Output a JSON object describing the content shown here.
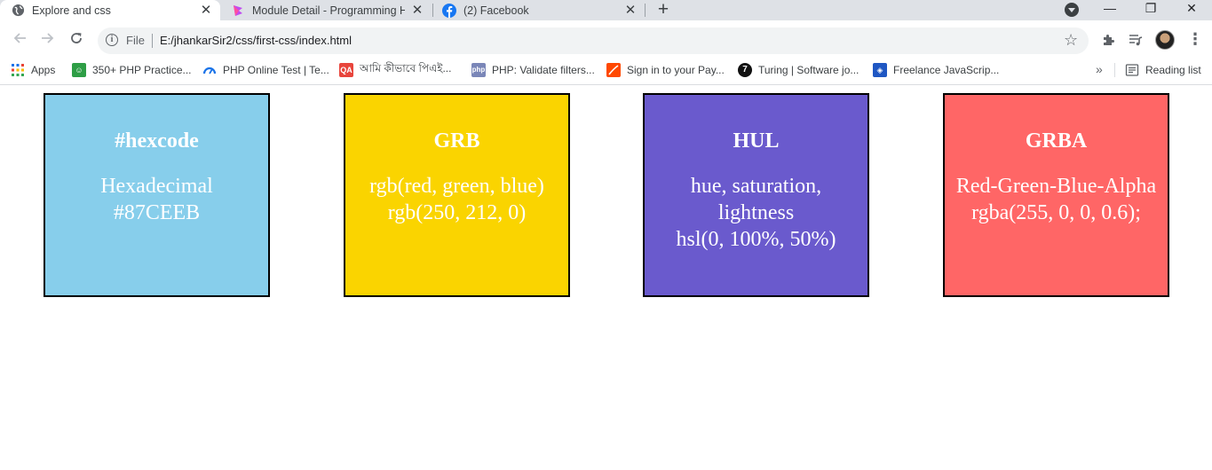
{
  "browser": {
    "tabs": [
      {
        "title": "Explore and css",
        "favicon": "globe-icon",
        "active": true
      },
      {
        "title": "Module Detail - Programming He",
        "favicon": "programming-hero-icon",
        "active": false
      },
      {
        "title": "(2) Facebook",
        "favicon": "facebook-icon",
        "active": false
      }
    ],
    "new_tab_label": "+",
    "window_controls": {
      "minimize": "—",
      "restore": "❐",
      "close": "✕"
    },
    "address": {
      "scheme_label": "File",
      "url": "E:/jhankarSir2/css/first-css/index.html"
    },
    "bookmarks": [
      {
        "label": "Apps",
        "icon": "apps-grid-icon"
      },
      {
        "label": "350+ PHP Practice...",
        "icon": "php-practice-icon"
      },
      {
        "label": "PHP Online Test | Te...",
        "icon": "php-test-icon"
      },
      {
        "label": "আমি কীভাবে পিএই...",
        "icon": "qa-icon"
      },
      {
        "label": "PHP: Validate filters...",
        "icon": "php-icon"
      },
      {
        "label": "Sign in to your Pay...",
        "icon": "payoneer-icon"
      },
      {
        "label": "Turing | Software jo...",
        "icon": "turing-icon"
      },
      {
        "label": "Freelance JavaScrip...",
        "icon": "freelance-icon"
      }
    ],
    "bookmarks_more": "»",
    "reading_list_label": "Reading list"
  },
  "colors": {
    "card_hex": "#87CEEB",
    "card_rgb": "#FAD400",
    "card_hsl": "#6A5ACD",
    "card_rgba": "#FF6666"
  },
  "cards": [
    {
      "title": "#hexcode",
      "lines": [
        "Hexadecimal",
        "#87CEEB"
      ]
    },
    {
      "title": "GRB",
      "lines": [
        "rgb(red, green, blue)",
        "rgb(250, 212, 0)"
      ]
    },
    {
      "title": "HUL",
      "lines": [
        "hue, saturation,",
        "lightness",
        "hsl(0, 100%, 50%)"
      ]
    },
    {
      "title": "GRBA",
      "lines": [
        "Red-Green-Blue-Alpha",
        "rgba(255, 0, 0, 0.6);"
      ]
    }
  ]
}
